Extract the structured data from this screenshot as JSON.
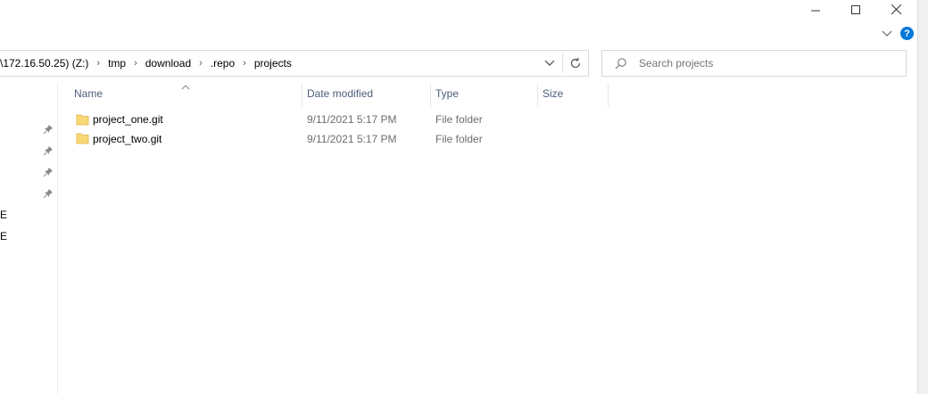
{
  "window": {
    "controls": {
      "minimize": "—",
      "maximize": "☐",
      "close": "✕"
    }
  },
  "ribbon": {
    "help_label": "?"
  },
  "address": {
    "crumbs": [
      "\\172.16.50.25) (Z:)",
      "tmp",
      "download",
      ".repo",
      "projects"
    ],
    "separator": "›"
  },
  "search": {
    "placeholder": "Search projects"
  },
  "columns": {
    "name": "Name",
    "date": "Date modified",
    "type": "Type",
    "size": "Size"
  },
  "files": [
    {
      "name": "project_one.git",
      "date": "9/11/2021 5:17 PM",
      "type": "File folder",
      "size": ""
    },
    {
      "name": "project_two.git",
      "date": "9/11/2021 5:17 PM",
      "type": "File folder",
      "size": ""
    }
  ],
  "sidebar": {
    "truncated_items": [
      "E",
      "E"
    ]
  },
  "colors": {
    "accent": "#0078d7",
    "folder": "#f8d775",
    "header_text": "#4c607a"
  }
}
